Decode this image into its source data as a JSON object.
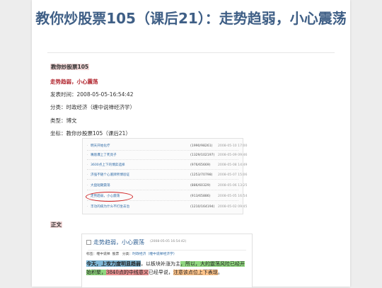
{
  "page": {
    "title": "教你炒股票105（课后21）：走势趋弱，小心震荡",
    "series_name": "教你炒股票105",
    "subtitle": "走势趋弱，小心震荡",
    "published": "发表时间：2008-05-05-16:54:42",
    "category": "分类：时政经济（缠中说禅经济学）",
    "type": "类型：博文",
    "coordinate": "坐标：教你炒股票105（课后21）",
    "body_heading": "正文"
  },
  "list_screenshot": {
    "items": [
      {
        "title": "明天开始化疗",
        "counts": "(1990/98261)",
        "date": "2008-05-10 17:00"
      },
      {
        "title": "嘴唇爆上了死亮子",
        "counts": "(1329/102197)",
        "date": "2008-05-09 09:46"
      },
      {
        "title": "3600点上下的博弈选择",
        "counts": "(976/65669)",
        "date": "2008-05-08 14:49"
      },
      {
        "title": "济强不随个心底牌所博验证",
        "counts": "(1253/70798)",
        "date": "2008-05-07 15:06"
      },
      {
        "title": "大盘短期震荡",
        "counts": "(886/60329)",
        "date": "2008-05-06 13:25"
      },
      {
        "title": "走势趋弱，小心震荡",
        "counts": "(913/65886)",
        "date": "2008-05-05 16:54"
      },
      {
        "title": "丰功的病为什么不打坐去治",
        "counts": "(1210/164194)",
        "date": "2008-05-02 09:45"
      }
    ]
  },
  "article_screenshot": {
    "title": "走势趋弱，小心震荡",
    "date": "(2008-05-05 16:54:42)",
    "tags_label": "标签：",
    "tag": "缠中说禅",
    "tag2": "股票",
    "category_label": "分类：",
    "category_value": "时政经济（缠中说禅经济学）",
    "seg1": "今天，上攻力度明显趋弱",
    "seg2": "，以板块补涨为主",
    "seg3": "，所以，大的震荡风险已经开始积聚，",
    "seg4": "3840点的中线意义",
    "seg5": "已经早说，",
    "seg6": "注意该点位上下表现",
    "seg7": "。"
  },
  "colors": {
    "title": "#3f5f86",
    "link": "#2e6aa6",
    "highlight_circle": "#d02020"
  }
}
